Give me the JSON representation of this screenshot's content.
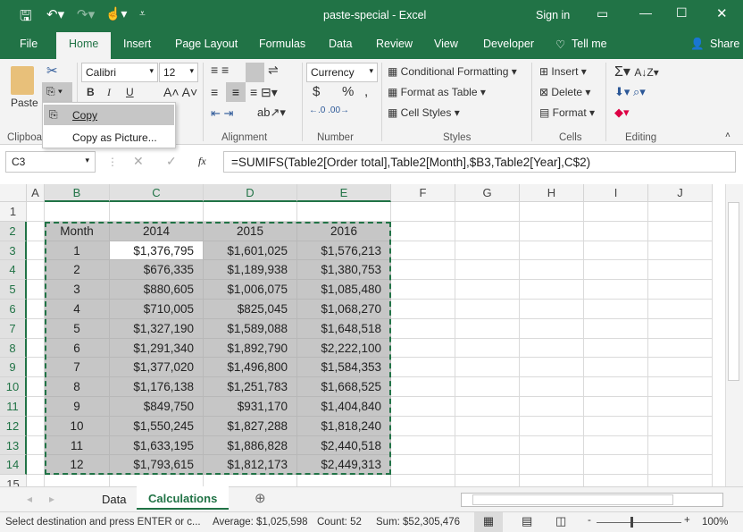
{
  "window": {
    "title": "paste-special - Excel",
    "sign_in": "Sign in"
  },
  "ribbon_tabs": [
    "File",
    "Home",
    "Insert",
    "Page Layout",
    "Formulas",
    "Data",
    "Review",
    "View",
    "Developer"
  ],
  "tell_me": "Tell me",
  "share": "Share",
  "clipboard": {
    "paste": "Paste",
    "group": "Clipboard"
  },
  "font": {
    "name": "Calibri",
    "size": "12",
    "bold": "B",
    "italic": "I",
    "underline": "U"
  },
  "alignment": {
    "group": "Alignment"
  },
  "number": {
    "format": "Currency",
    "group": "Number",
    "dollar": "$",
    "percent": "%",
    "comma": ","
  },
  "styles": {
    "conditional": "Conditional Formatting",
    "table": "Format as Table",
    "cell": "Cell Styles",
    "group": "Styles"
  },
  "cells": {
    "insert": "Insert",
    "delete": "Delete",
    "format": "Format",
    "group": "Cells"
  },
  "editing": {
    "group": "Editing"
  },
  "copy_menu": {
    "items": [
      "Copy",
      "Copy as Picture..."
    ]
  },
  "formula_bar": {
    "name_box": "C3",
    "fx": "fx",
    "formula": "=SUMIFS(Table2[Order total],Table2[Month],$B3,Table2[Year],C$2)"
  },
  "columns": [
    "A",
    "B",
    "C",
    "D",
    "E",
    "F",
    "G",
    "H",
    "I",
    "J"
  ],
  "rows": [
    "1",
    "2",
    "3",
    "4",
    "5",
    "6",
    "7",
    "8",
    "9",
    "10",
    "11",
    "12",
    "13",
    "14",
    "15"
  ],
  "table": {
    "headers": [
      "Month",
      "2014",
      "2015",
      "2016"
    ],
    "rows": [
      [
        "1",
        "$1,376,795",
        "$1,601,025",
        "$1,576,213"
      ],
      [
        "2",
        "$676,335",
        "$1,189,938",
        "$1,380,753"
      ],
      [
        "3",
        "$880,605",
        "$1,006,075",
        "$1,085,480"
      ],
      [
        "4",
        "$710,005",
        "$825,045",
        "$1,068,270"
      ],
      [
        "5",
        "$1,327,190",
        "$1,589,088",
        "$1,648,518"
      ],
      [
        "6",
        "$1,291,340",
        "$1,892,790",
        "$2,222,100"
      ],
      [
        "7",
        "$1,377,020",
        "$1,496,800",
        "$1,584,353"
      ],
      [
        "8",
        "$1,176,138",
        "$1,251,783",
        "$1,668,525"
      ],
      [
        "9",
        "$849,750",
        "$931,170",
        "$1,404,840"
      ],
      [
        "10",
        "$1,550,245",
        "$1,827,288",
        "$1,818,240"
      ],
      [
        "11",
        "$1,633,195",
        "$1,886,828",
        "$2,440,518"
      ],
      [
        "12",
        "$1,793,615",
        "$1,812,173",
        "$2,449,313"
      ]
    ]
  },
  "sheets": [
    "Data",
    "Calculations"
  ],
  "active_sheet": "Calculations",
  "status": {
    "message": "Select destination and press ENTER or c...",
    "average": "Average: $1,025,598",
    "count": "Count: 52",
    "sum": "Sum: $52,305,476",
    "zoom": "100%"
  },
  "colors": {
    "accent": "#217346",
    "selection": "#c6c6c6"
  }
}
